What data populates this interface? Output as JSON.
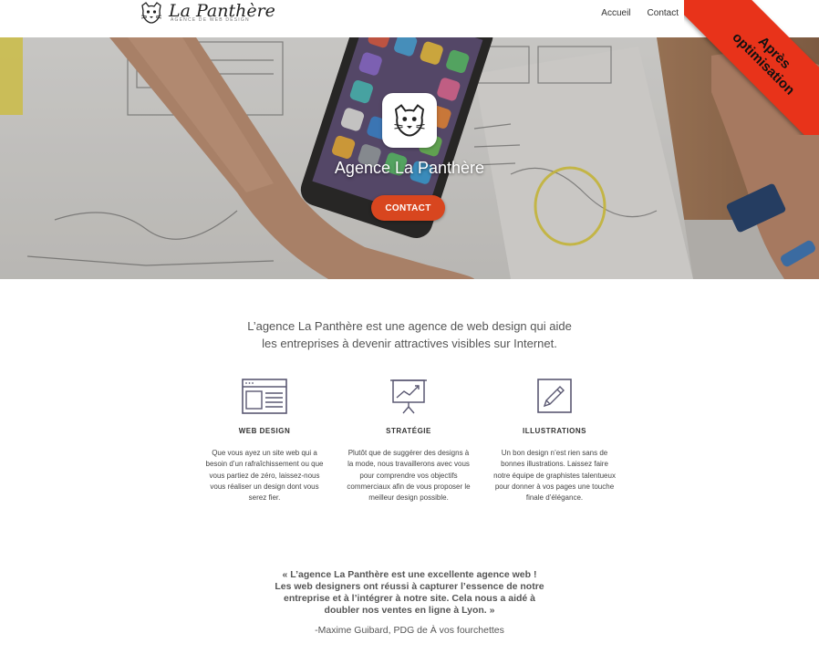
{
  "header": {
    "logo_name": "La Panthère",
    "logo_tagline": "Agence de web design",
    "nav": [
      "Accueil",
      "Contact"
    ],
    "ribbon": "Après optimisation"
  },
  "hero": {
    "title": "Agence La Panthère",
    "cta_label": "CONTACT"
  },
  "intro": {
    "lines": [
      "L’agence La Panthère est une agence de web design qui aide",
      "les entreprises à devenir attractives visibles sur Internet."
    ]
  },
  "features": [
    {
      "icon": "browser-window-icon",
      "title": "WEB DESIGN",
      "lines": [
        "Que vous ayez un site web qui a",
        "besoin d’un rafraîchissement ou que",
        "vous partiez de zéro, laissez-nous",
        "vous réaliser un design dont vous",
        "serez fier."
      ]
    },
    {
      "icon": "presentation-chart-icon",
      "title": "STRATÉGIE",
      "lines": [
        "Plutôt que de suggérer des designs à",
        "la mode, nous travaillerons avec vous",
        "pour comprendre vos objectifs",
        "commerciaux afin de vous proposer le",
        "meilleur design possible."
      ]
    },
    {
      "icon": "pencil-square-icon",
      "title": "ILLUSTRATIONS",
      "lines": [
        "Un bon design n’est rien sans de",
        "bonnes illustrations. Laissez faire",
        "notre équipe de graphistes talentueux",
        "pour donner à vos pages une touche",
        "finale d’élégance."
      ]
    }
  ],
  "testimonial": {
    "lines": [
      "« L’agence La Panthère est une excellente agence web !",
      "Les web designers ont réussi à capturer l’essence de notre",
      "entreprise et à l’intégrer à notre site. Cela nous a aidé à",
      "doubler nos ventes en ligne à Lyon. »"
    ],
    "author": "-Maxime Guibard, PDG de À vos fourchettes"
  },
  "colors": {
    "accent": "#d8461f",
    "ribbon": "#e8331a",
    "icon": "#5a5872"
  }
}
